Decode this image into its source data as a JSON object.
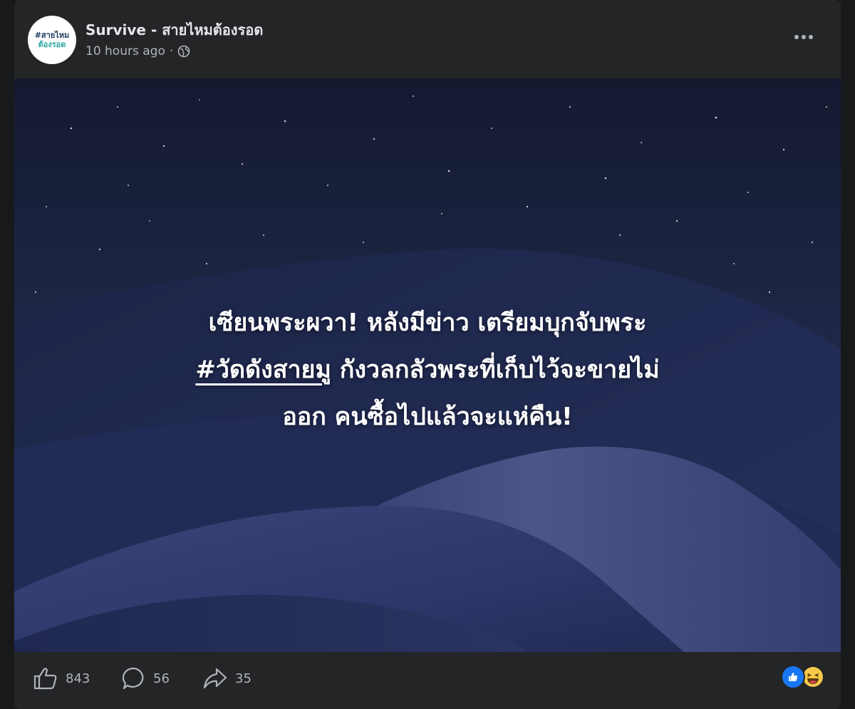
{
  "post": {
    "page_name": "Survive - สายไหมต้องรอด",
    "avatar_line1": "#สายไหม",
    "avatar_line2": "ต้องรอด",
    "time": "10 hours ago",
    "separator": "·",
    "audience_icon": "globe-icon",
    "more_icon": "more-horizontal-icon"
  },
  "image": {
    "headline_line1": "เซียนพระผวา! หลังมีข่าว เตรียมบุกจับพระ",
    "headline_hashtag": "#วัดดังสายมู",
    "headline_line2_rest": " กังวลกลัวพระที่เก็บไว้จะขายไม่",
    "headline_line3": "ออก คนซื้อไปแล้วจะแห่คืน!"
  },
  "actions": {
    "like_count": "843",
    "comment_count": "56",
    "share_count": "35",
    "like_icon": "thumbs-up-icon",
    "comment_icon": "comment-bubble-icon",
    "share_icon": "share-arrow-icon"
  },
  "reactions": [
    "like-reaction-icon",
    "haha-reaction-icon"
  ],
  "colors": {
    "background": "#242526",
    "text_primary": "#e4e6eb",
    "text_secondary": "#b0b3b8",
    "like_blue": "#1877f2",
    "sky": "#1a2340",
    "dune": "#2a3563"
  }
}
